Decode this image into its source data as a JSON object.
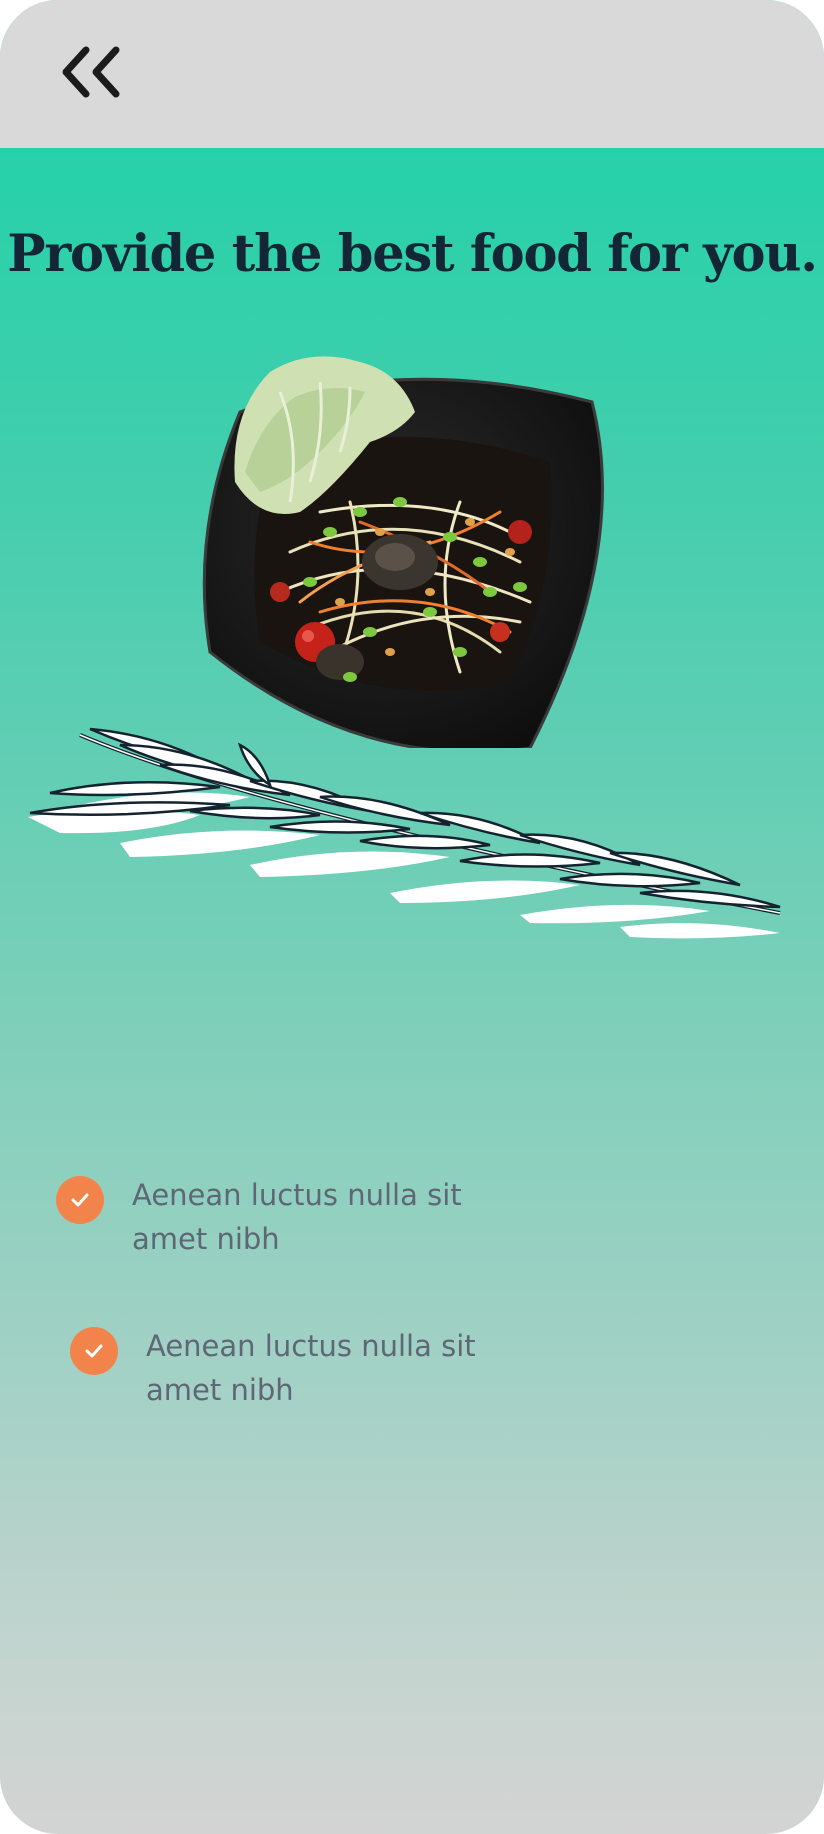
{
  "header": {
    "back_icon": "double-chevron-left-icon"
  },
  "hero": {
    "title": "Provide the best food for you.",
    "image_name": "papaya-salad-plate-image",
    "decoration_name": "rosemary-sprig-illustration"
  },
  "features": [
    {
      "text": "Aenean luctus nulla sit amet nibh",
      "icon": "check-icon"
    },
    {
      "text": "Aenean luctus nulla sit amet nibh",
      "icon": "check-icon"
    }
  ],
  "colors": {
    "accent": "#f2834b",
    "top_teal": "#26d1a9",
    "bottom_gray": "#d3d3d3",
    "header_bg": "#d9d9d9",
    "title": "#132635",
    "body_text": "#5e6874"
  }
}
